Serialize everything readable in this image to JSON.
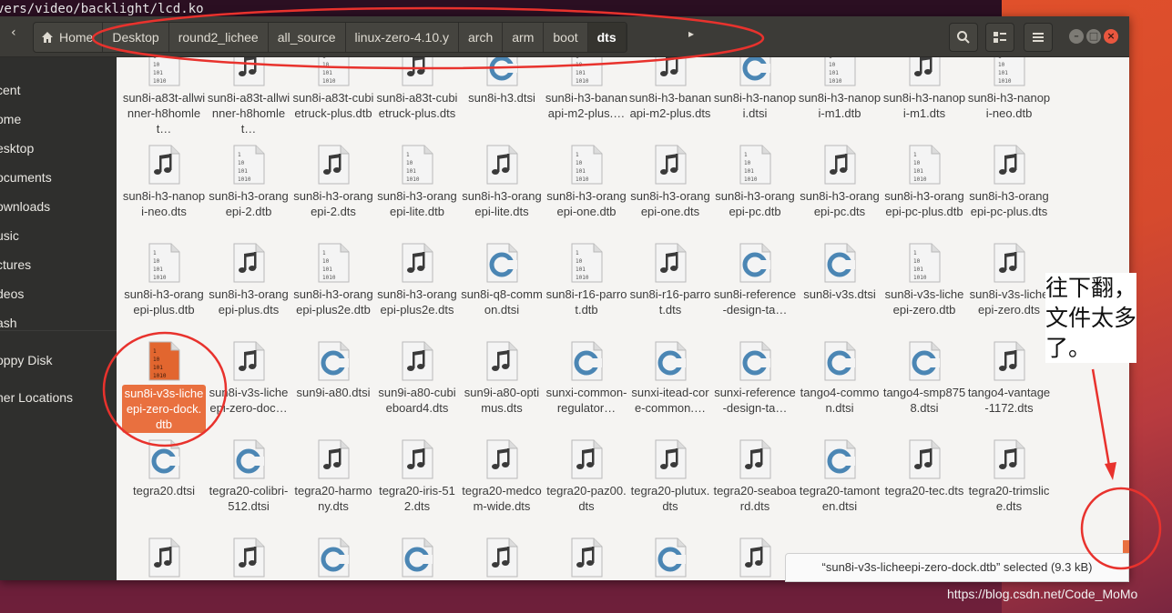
{
  "terminal": {
    "text": "vers/video/backlight/lcd.ko"
  },
  "pathbar": {
    "items": [
      "Home",
      "Desktop",
      "round2_lichee",
      "all_source",
      "linux-zero-4.10.y",
      "arch",
      "arm",
      "boot",
      "dts"
    ]
  },
  "sidebar": {
    "items": [
      "cent",
      "ome",
      "esktop",
      "ocuments",
      "ownloads",
      "usic",
      "ctures",
      "deos",
      "ash",
      "oppy Disk",
      "her Locations"
    ]
  },
  "files": [
    {
      "name": "sun8i-a83t-allwinner-h8homlet…",
      "type": "dtb"
    },
    {
      "name": "sun8i-a83t-allwinner-h8homlet…",
      "type": "dts"
    },
    {
      "name": "sun8i-a83t-cubietruck-plus.dtb",
      "type": "dtb"
    },
    {
      "name": "sun8i-a83t-cubietruck-plus.dts",
      "type": "dts"
    },
    {
      "name": "sun8i-h3.dtsi",
      "type": "dtsi"
    },
    {
      "name": "sun8i-h3-bananapi-m2-plus.…",
      "type": "dtb"
    },
    {
      "name": "sun8i-h3-bananapi-m2-plus.dts",
      "type": "dts"
    },
    {
      "name": "sun8i-h3-nanopi.dtsi",
      "type": "dtsi"
    },
    {
      "name": "sun8i-h3-nanopi-m1.dtb",
      "type": "dtb"
    },
    {
      "name": "sun8i-h3-nanopi-m1.dts",
      "type": "dts"
    },
    {
      "name": "sun8i-h3-nanopi-neo.dtb",
      "type": "dtb"
    },
    {
      "name": "sun8i-h3-nanopi-neo.dts",
      "type": "dts"
    },
    {
      "name": "sun8i-h3-orangepi-2.dtb",
      "type": "dtb"
    },
    {
      "name": "sun8i-h3-orangepi-2.dts",
      "type": "dts"
    },
    {
      "name": "sun8i-h3-orangepi-lite.dtb",
      "type": "dtb"
    },
    {
      "name": "sun8i-h3-orangepi-lite.dts",
      "type": "dts"
    },
    {
      "name": "sun8i-h3-orangepi-one.dtb",
      "type": "dtb"
    },
    {
      "name": "sun8i-h3-orangepi-one.dts",
      "type": "dts"
    },
    {
      "name": "sun8i-h3-orangepi-pc.dtb",
      "type": "dtb"
    },
    {
      "name": "sun8i-h3-orangepi-pc.dts",
      "type": "dts"
    },
    {
      "name": "sun8i-h3-orangepi-pc-plus.dtb",
      "type": "dtb"
    },
    {
      "name": "sun8i-h3-orangepi-pc-plus.dts",
      "type": "dts"
    },
    {
      "name": "sun8i-h3-orangepi-plus.dtb",
      "type": "dtb"
    },
    {
      "name": "sun8i-h3-orangepi-plus.dts",
      "type": "dts"
    },
    {
      "name": "sun8i-h3-orangepi-plus2e.dtb",
      "type": "dtb"
    },
    {
      "name": "sun8i-h3-orangepi-plus2e.dts",
      "type": "dts"
    },
    {
      "name": "sun8i-q8-common.dtsi",
      "type": "dtsi"
    },
    {
      "name": "sun8i-r16-parrot.dtb",
      "type": "dtb"
    },
    {
      "name": "sun8i-r16-parrot.dts",
      "type": "dts"
    },
    {
      "name": "sun8i-reference-design-ta…",
      "type": "dtsi"
    },
    {
      "name": "sun8i-v3s.dtsi",
      "type": "dtsi"
    },
    {
      "name": "sun8i-v3s-licheepi-zero.dtb",
      "type": "dtb"
    },
    {
      "name": "sun8i-v3s-licheepi-zero.dts",
      "type": "dts"
    },
    {
      "name": "sun8i-v3s-licheepi-zero-dock.dtb",
      "type": "dtb",
      "selected": true
    },
    {
      "name": "sun8i-v3s-licheepi-zero-doc…",
      "type": "dts"
    },
    {
      "name": "sun9i-a80.dtsi",
      "type": "dtsi"
    },
    {
      "name": "sun9i-a80-cubieboard4.dts",
      "type": "dts"
    },
    {
      "name": "sun9i-a80-optimus.dts",
      "type": "dts"
    },
    {
      "name": "sunxi-common-regulator…",
      "type": "dtsi"
    },
    {
      "name": "sunxi-itead-core-common.…",
      "type": "dtsi"
    },
    {
      "name": "sunxi-reference-design-ta…",
      "type": "dtsi"
    },
    {
      "name": "tango4-common.dtsi",
      "type": "dtsi"
    },
    {
      "name": "tango4-smp8758.dtsi",
      "type": "dtsi"
    },
    {
      "name": "tango4-vantage-1172.dts",
      "type": "dts"
    },
    {
      "name": "tegra20.dtsi",
      "type": "dtsi"
    },
    {
      "name": "tegra20-colibri-512.dtsi",
      "type": "dtsi"
    },
    {
      "name": "tegra20-harmony.dts",
      "type": "dts"
    },
    {
      "name": "tegra20-iris-512.dts",
      "type": "dts"
    },
    {
      "name": "tegra20-medcom-wide.dts",
      "type": "dts"
    },
    {
      "name": "tegra20-paz00.dts",
      "type": "dts"
    },
    {
      "name": "tegra20-plutux.dts",
      "type": "dts"
    },
    {
      "name": "tegra20-seaboard.dts",
      "type": "dts"
    },
    {
      "name": "tegra20-tamonten.dtsi",
      "type": "dtsi"
    },
    {
      "name": "tegra20-tec.dts",
      "type": "dts"
    },
    {
      "name": "tegra20-trimslice.dts",
      "type": "dts"
    },
    {
      "name": "",
      "type": "dts"
    },
    {
      "name": "",
      "type": "dts"
    },
    {
      "name": "",
      "type": "dtsi"
    },
    {
      "name": "",
      "type": "dtsi"
    },
    {
      "name": "",
      "type": "dts"
    },
    {
      "name": "",
      "type": "dts"
    },
    {
      "name": "",
      "type": "dtsi"
    },
    {
      "name": "",
      "type": "dts"
    }
  ],
  "status": {
    "text": "“sun8i-v3s-licheepi-zero-dock.dtb” selected  (9.3 kB)"
  },
  "annotation": {
    "line1": "往下翻，",
    "line2": "文件太多",
    "line3": "了。"
  },
  "watermark": {
    "text": "https://blog.csdn.net/Code_MoMo"
  },
  "colors": {
    "accent": "#e9703f",
    "annotation_red": "#e8322d",
    "header": "#3c3b37",
    "sidebar": "#2f2f2d"
  },
  "icons": {
    "dtb": "binary-file-icon",
    "dts": "music-note-file-icon",
    "dtsi": "c-source-file-icon"
  }
}
